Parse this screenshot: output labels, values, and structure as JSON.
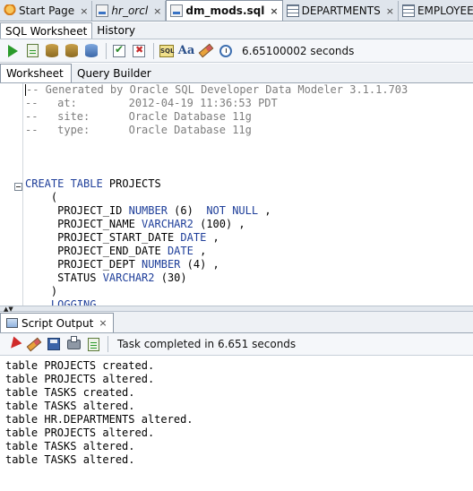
{
  "doc_tabs": [
    {
      "label": "Start Page",
      "icon": "start-page-icon",
      "italic": false,
      "active": false
    },
    {
      "label": "hr_orcl",
      "icon": "sql-connection-icon",
      "italic": true,
      "active": false
    },
    {
      "label": "dm_mods.sql",
      "icon": "sql-file-icon",
      "italic": false,
      "active": true
    },
    {
      "label": "DEPARTMENTS",
      "icon": "table-grid-icon",
      "italic": false,
      "active": false
    },
    {
      "label": "EMPLOYEES",
      "icon": "table-grid-icon",
      "italic": false,
      "active": false
    }
  ],
  "close_glyph": "×",
  "worksheet_tabs": [
    "SQL Worksheet",
    "History"
  ],
  "toolbar": {
    "elapsed": "6.65100002 seconds"
  },
  "editor_tabs": [
    "Worksheet",
    "Query Builder"
  ],
  "code_lines": [
    [
      {
        "t": "cm",
        "v": "-- Generated by Oracle SQL Developer Data Modeler 3.1.1.703"
      }
    ],
    [
      {
        "t": "cm",
        "v": "--   at:        2012-04-19 11:36:53 PDT"
      }
    ],
    [
      {
        "t": "cm",
        "v": "--   site:      Oracle Database 11g"
      }
    ],
    [
      {
        "t": "cm",
        "v": "--   type:      Oracle Database 11g"
      }
    ],
    [],
    [],
    [],
    [
      {
        "t": "kw",
        "v": "CREATE TABLE"
      },
      {
        "t": "tx",
        "v": " PROJECTS"
      }
    ],
    [
      {
        "t": "tx",
        "v": "    ("
      }
    ],
    [
      {
        "t": "tx",
        "v": "     PROJECT_ID "
      },
      {
        "t": "kw",
        "v": "NUMBER"
      },
      {
        "t": "tx",
        "v": " (6)  "
      },
      {
        "t": "kw",
        "v": "NOT NULL"
      },
      {
        "t": "tx",
        "v": " ,"
      }
    ],
    [
      {
        "t": "tx",
        "v": "     PROJECT_NAME "
      },
      {
        "t": "kw",
        "v": "VARCHAR2"
      },
      {
        "t": "tx",
        "v": " (100) ,"
      }
    ],
    [
      {
        "t": "tx",
        "v": "     PROJECT_START_DATE "
      },
      {
        "t": "kw",
        "v": "DATE"
      },
      {
        "t": "tx",
        "v": " ,"
      }
    ],
    [
      {
        "t": "tx",
        "v": "     PROJECT_END_DATE "
      },
      {
        "t": "kw",
        "v": "DATE"
      },
      {
        "t": "tx",
        "v": " ,"
      }
    ],
    [
      {
        "t": "tx",
        "v": "     PROJECT_DEPT "
      },
      {
        "t": "kw",
        "v": "NUMBER"
      },
      {
        "t": "tx",
        "v": " (4) ,"
      }
    ],
    [
      {
        "t": "tx",
        "v": "     STATUS "
      },
      {
        "t": "kw",
        "v": "VARCHAR2"
      },
      {
        "t": "tx",
        "v": " (30)"
      }
    ],
    [
      {
        "t": "tx",
        "v": "    )"
      }
    ],
    [
      {
        "t": "kw",
        "v": "    LOGGING"
      }
    ]
  ],
  "output_panel": {
    "tab_label": "Script Output",
    "status": "Task completed in 6.651 seconds",
    "lines": [
      "table PROJECTS created.",
      "table PROJECTS altered.",
      "table TASKS created.",
      "table TASKS altered.",
      "table HR.DEPARTMENTS altered.",
      "table PROJECTS altered.",
      "table TASKS altered.",
      "table TASKS altered."
    ]
  },
  "colors": {
    "keyword": "#1f3f9a",
    "comment": "#7d7d7d",
    "run_green": "#2b9b2b"
  }
}
